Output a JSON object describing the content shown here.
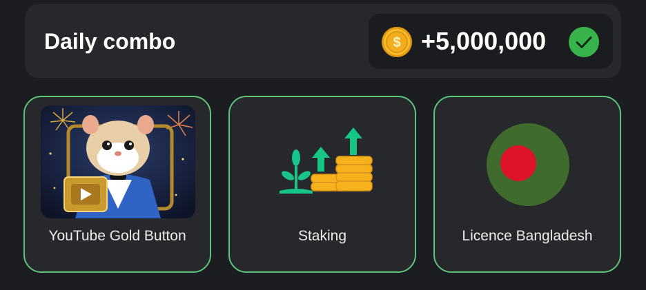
{
  "combo": {
    "title": "Daily combo",
    "reward": "+5,000,000",
    "coin_icon": "dollar-coin-icon",
    "status_icon": "check-circle-icon"
  },
  "cards": [
    {
      "label": "YouTube Gold Button",
      "image": "hamster-gold-button-illustration",
      "status": "unlocked"
    },
    {
      "label": "Staking",
      "image": "staking-growth-icon",
      "status": "unlocked"
    },
    {
      "label": "Licence Bangladesh",
      "image": "bangladesh-flag-icon",
      "status": "unlocked"
    }
  ],
  "colors": {
    "background": "#1c1d21",
    "panel": "#27282c",
    "active_border": "#5ec47a",
    "check_green": "#38b34c",
    "coin_gold": "#f5b21c",
    "staking_green": "#17c489",
    "bangladesh_green": "#3f6b2c",
    "bangladesh_red": "#dd1327"
  }
}
